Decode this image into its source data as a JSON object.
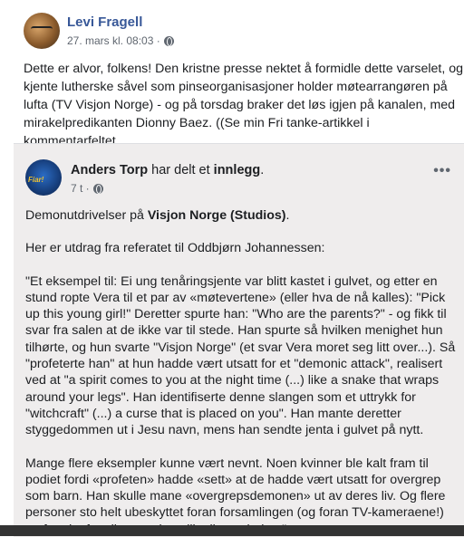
{
  "post": {
    "author": "Levi Fragell",
    "timestamp": "27. mars kl. 08:03 ·",
    "privacy_icon": "globe-icon",
    "text": "Dette er alvor, folkens! Den kristne presse nektet å formidle dette varselet, og kjente lutherske såvel som pinseorganisasjoner holder møtearrangøren på lufta (TV Visjon Norge) - og på torsdag braker det løs igjen på kanalen, med mirakelpredikanten Dionny Baez. ((Se min Fri tanke-artikkel i kommentarfeltet."
  },
  "shared": {
    "author": "Anders Torp",
    "action_mid": " har delt et ",
    "action_end": "innlegg",
    "period": ".",
    "timestamp": "7 t ·",
    "intro_prefix": "Demonutdrivelser på ",
    "intro_bold": "Visjon Norge (Studios)",
    "intro_suffix": ".",
    "p1": "Her er utdrag fra referatet til Oddbjørn Johannessen:",
    "p2": "\"Et eksempel til: Ei ung tenåringsjente var blitt kastet i gulvet, og etter en stund ropte Vera til et par av «møtevertene» (eller hva de nå kalles):  \"Pick up this young girl!\"  Deretter spurte han: \"Who are the parents?\" - og fikk til svar fra salen at de ikke var til stede.  Han spurte så hvilken menighet hun tilhørte, og hun svarte \"Visjon Norge\" (et svar Vera moret seg litt over...).  Så \"profeterte han\" at hun hadde vært utsatt for et \"demonic attack\", realisert ved at \"a spirit comes to you at the night time (...) like a snake that wraps around your legs\".  Han identifiserte denne slangen som et uttrykk for \"witchcraft\" (...) a curse that is placed on you\".  Han mante deretter styggedommen ut i Jesu navn, mens han sendte jenta i gulvet på nytt.",
    "p3": "Mange flere eksempler kunne vært nevnt. Noen kvinner ble kalt fram til podiet fordi «profeten» hadde «sett» at de hadde vært utsatt for overgrep som barn. Han skulle mane «overgrepsdemonen» ut av deres liv. Og flere personer sto helt ubeskyttet foran forsamlingen (og foran TV-kameraene!) og fortalte fortvilet om sine ulike livsnederlag.\""
  }
}
